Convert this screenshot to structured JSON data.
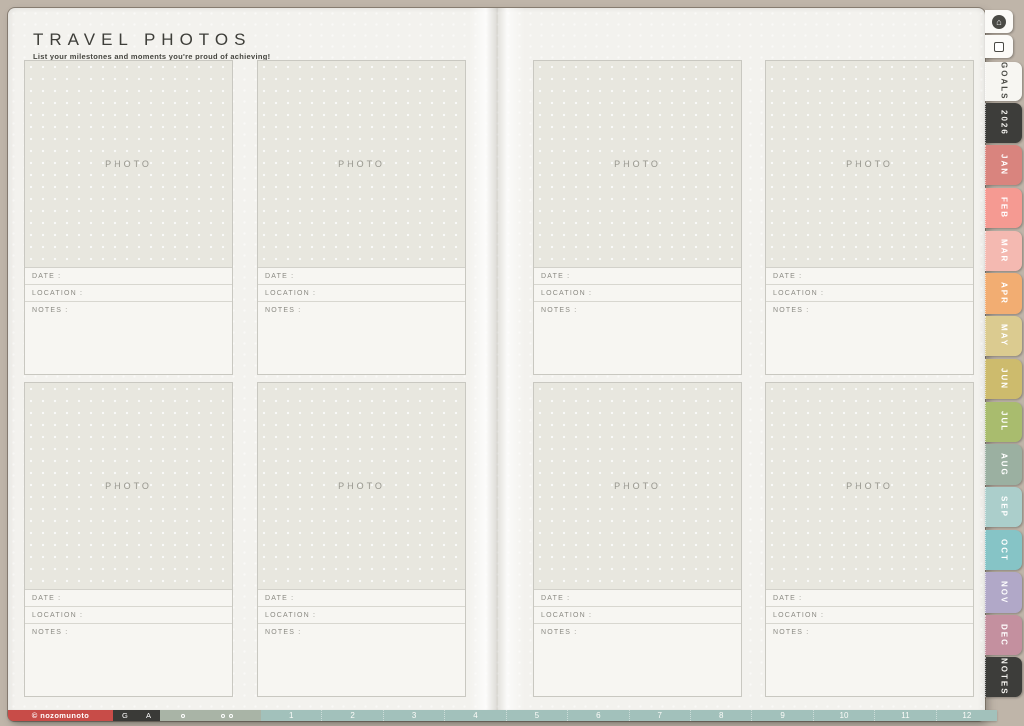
{
  "header": {
    "title": "TRAVEL PHOTOS",
    "subtitle": "List your milestones and moments you're proud of achieving!"
  },
  "photo_card": {
    "placeholder": "PHOTO",
    "date_label": "DATE :",
    "location_label": "LOCATION :",
    "notes_label": "NOTES :"
  },
  "side_icons": {
    "home": "⌂"
  },
  "nav_tabs": {
    "items": [
      {
        "label": "GOALS",
        "bg": "#f7f6f2",
        "fg": "#4b4b46"
      },
      {
        "label": "2026",
        "bg": "#3d3d3a",
        "fg": "#f5f4f0"
      },
      {
        "label": "JAN",
        "bg": "#d9847e",
        "fg": "#ffffff"
      },
      {
        "label": "FEB",
        "bg": "#f59a92",
        "fg": "#ffffff"
      },
      {
        "label": "MAR",
        "bg": "#f4b9b1",
        "fg": "#ffffff"
      },
      {
        "label": "APR",
        "bg": "#f2ad72",
        "fg": "#ffffff"
      },
      {
        "label": "MAY",
        "bg": "#dbcb90",
        "fg": "#ffffff"
      },
      {
        "label": "JUN",
        "bg": "#cdbb6d",
        "fg": "#ffffff"
      },
      {
        "label": "JUL",
        "bg": "#a9bc6e",
        "fg": "#ffffff"
      },
      {
        "label": "AUG",
        "bg": "#9bb0a1",
        "fg": "#ffffff"
      },
      {
        "label": "SEP",
        "bg": "#abcecb",
        "fg": "#ffffff"
      },
      {
        "label": "OCT",
        "bg": "#86c4c6",
        "fg": "#ffffff"
      },
      {
        "label": "NOV",
        "bg": "#b1a8c8",
        "fg": "#ffffff"
      },
      {
        "label": "DEC",
        "bg": "#c4909f",
        "fg": "#ffffff"
      },
      {
        "label": "NOTES",
        "bg": "#3d3d3a",
        "fg": "#f5f4f0"
      }
    ]
  },
  "footer": {
    "copyright": "© nozomunoto",
    "links": [
      "G",
      "A"
    ],
    "months": [
      "1",
      "2",
      "3",
      "4",
      "5",
      "6",
      "7",
      "8",
      "9",
      "10",
      "11",
      "12"
    ]
  },
  "colors": {
    "desk": "#bfb5a9",
    "page": "#f3f2ee",
    "photo_box": "#e8e7df",
    "accent_red": "#c84c48",
    "dark": "#3a3a37",
    "sage": "#a9b4a6",
    "teal_bar": "#a2c1bb"
  }
}
